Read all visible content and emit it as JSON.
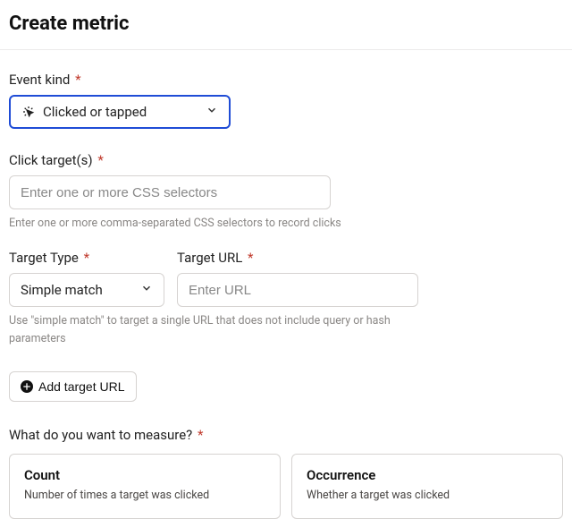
{
  "header": {
    "title": "Create metric"
  },
  "event_kind": {
    "label": "Event kind",
    "required": "*",
    "value": "Clicked or tapped"
  },
  "click_targets": {
    "label": "Click target(s)",
    "required": "*",
    "placeholder": "Enter one or more CSS selectors",
    "help": "Enter one or more comma-separated CSS selectors to record clicks"
  },
  "target_type": {
    "label": "Target Type",
    "required": "*",
    "value": "Simple match"
  },
  "target_url": {
    "label": "Target URL",
    "required": "*",
    "placeholder": "Enter URL"
  },
  "target_help": "Use \"simple match\" to target a single URL that does not include query or hash parameters",
  "add_target_btn": "Add target URL",
  "measure": {
    "label": "What do you want to measure?",
    "required": "*",
    "options": [
      {
        "title": "Count",
        "desc": "Number of times a target was clicked"
      },
      {
        "title": "Occurrence",
        "desc": "Whether a target was clicked"
      }
    ]
  }
}
